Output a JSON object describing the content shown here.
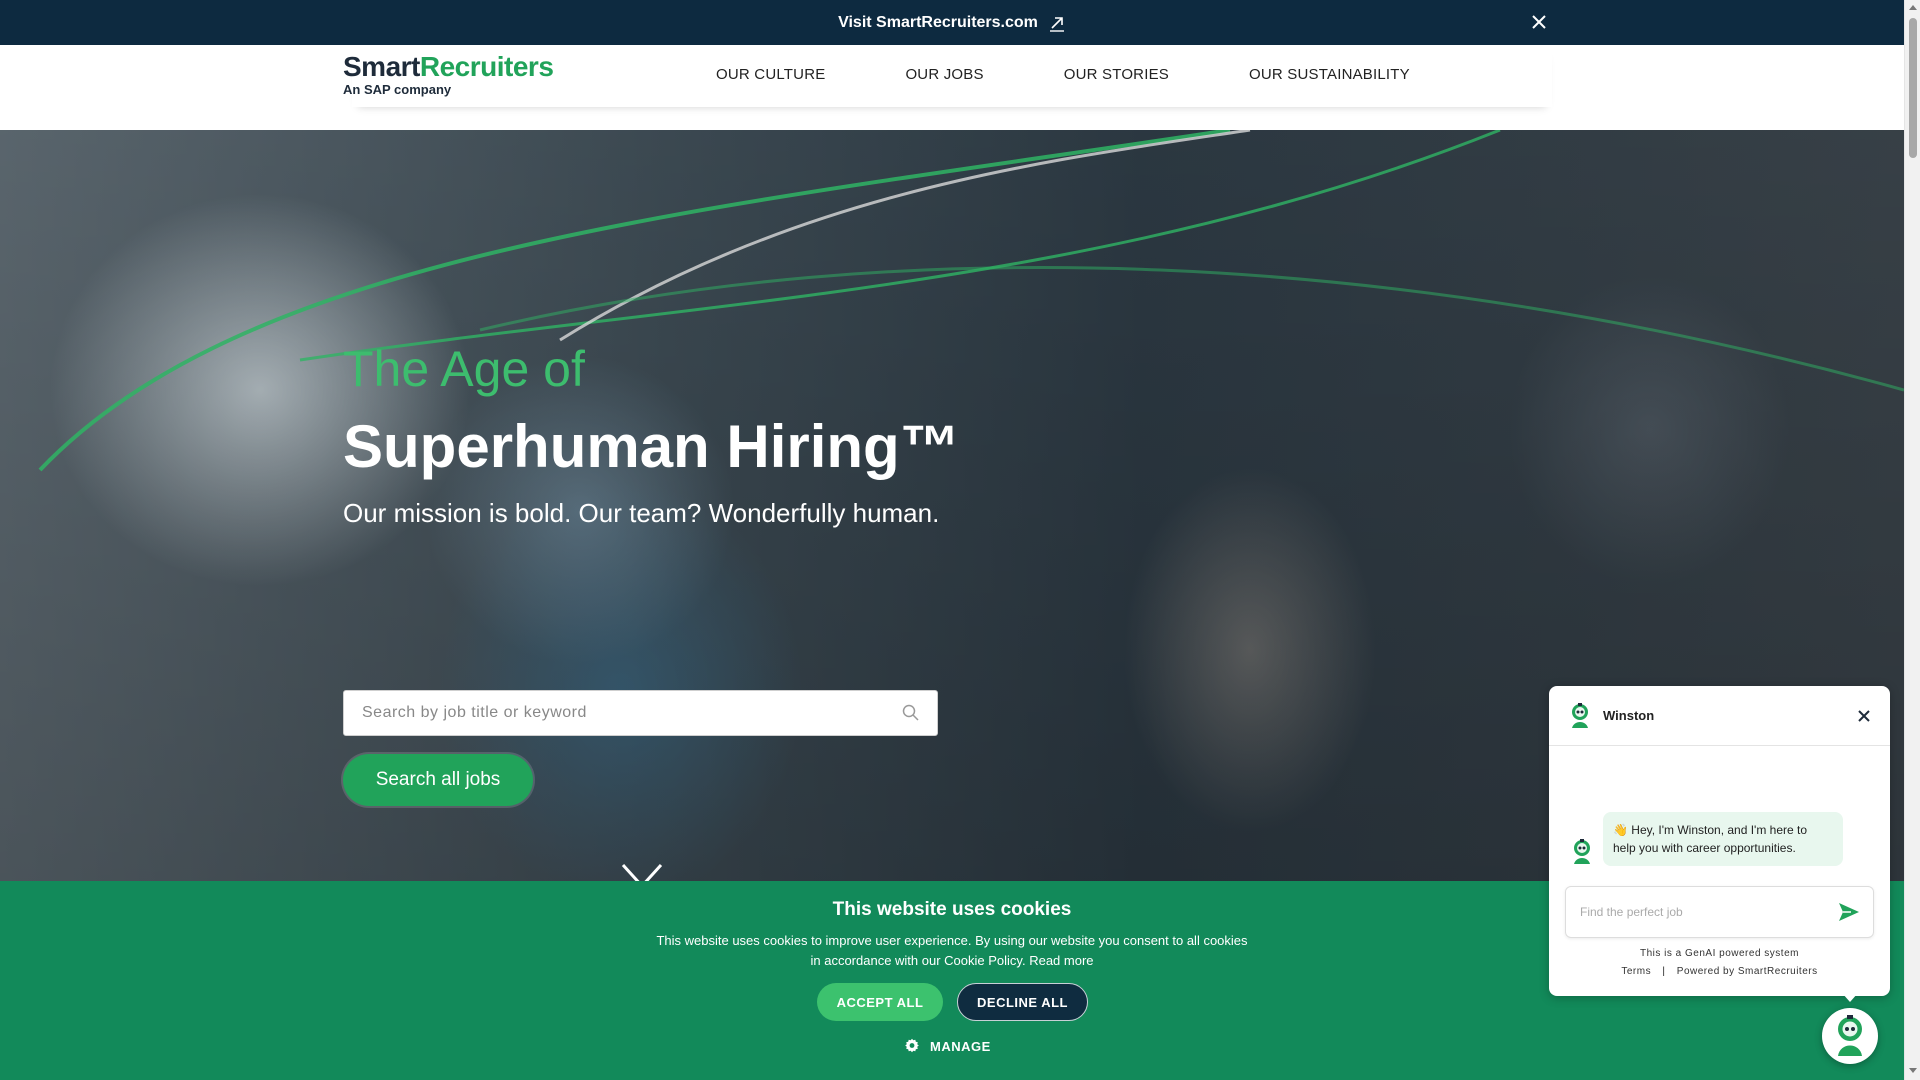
{
  "topbar": {
    "link_text": "Visit SmartRecruiters.com"
  },
  "logo": {
    "name_part1": "Smart",
    "name_part2": "Recruiters",
    "tagline": "An SAP company"
  },
  "nav": {
    "items": [
      {
        "label": "OUR CULTURE"
      },
      {
        "label": "OUR JOBS"
      },
      {
        "label": "OUR STORIES"
      },
      {
        "label": "OUR SUSTAINABILITY"
      }
    ]
  },
  "hero": {
    "eyebrow": "The Age of",
    "title": "Superhuman Hiring™",
    "subtitle": "Our mission is bold. Our team? Wonderfully human.",
    "search_placeholder": "Search by job title or keyword",
    "search_button": "Search all jobs"
  },
  "cookie": {
    "title": "This website uses cookies",
    "text": "This website uses cookies to improve user experience. By using our website you consent to all cookies in accordance with our Cookie Policy.",
    "read_more": "Read more",
    "accept": "ACCEPT ALL",
    "decline": "DECLINE ALL",
    "manage": "MANAGE"
  },
  "chat": {
    "name": "Winston",
    "message": "👋 Hey, I'm Winston, and I'm here to help you with career opportunities.",
    "input_placeholder": "Find the perfect job",
    "disclaimer": "This is a GenAI powered system",
    "terms": "Terms",
    "separator": "|",
    "powered_by": "Powered by SmartRecruiters"
  },
  "colors": {
    "brand_green": "#21a35a",
    "navy": "#0d2a40",
    "cookie_bg": "#128a5a"
  },
  "icons": [
    "external-link-icon",
    "close-icon",
    "search-icon",
    "chevron-down-icon",
    "gear-icon",
    "send-icon",
    "robot-avatar-icon"
  ]
}
